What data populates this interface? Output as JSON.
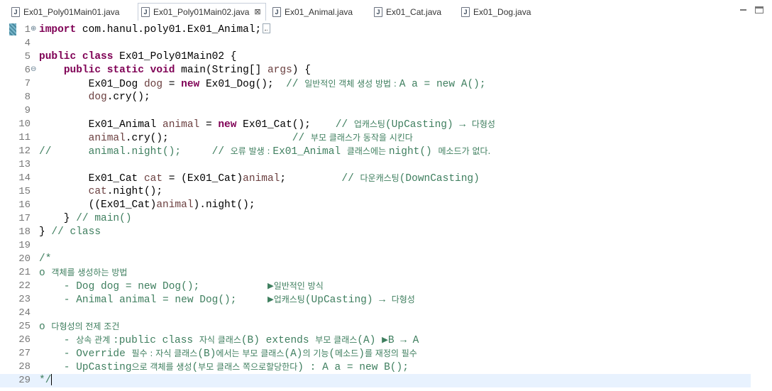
{
  "tabs": [
    {
      "label": "Ex01_Poly01Main01.java",
      "active": false
    },
    {
      "label": "Ex01_Poly01Main02.java",
      "active": true
    },
    {
      "label": "Ex01_Animal.java",
      "active": false
    },
    {
      "label": "Ex01_Cat.java",
      "active": false
    },
    {
      "label": "Ex01_Dog.java",
      "active": false
    }
  ],
  "icons": {
    "tab_file": "java-file-icon",
    "close": "close-icon",
    "minimize": "minimize-icon",
    "maximize": "maximize-icon"
  },
  "glyphs": {
    "file": "J",
    "close": "⊠"
  },
  "colors": {
    "keyword": "#7f0055",
    "comment": "#3f7f5f",
    "line_number": "#787878",
    "current_line": "#e8f2fe"
  },
  "editor": {
    "lines": [
      {
        "num": "1",
        "fold": "⊕",
        "segments": [
          [
            "kw",
            "import"
          ],
          [
            "t",
            " com.hanul.poly01.Ex01_Animal;"
          ]
        ],
        "collapsed": true
      },
      {
        "num": "4",
        "segments": []
      },
      {
        "num": "5",
        "segments": [
          [
            "kw",
            "public class"
          ],
          [
            "t",
            " Ex01_Poly01Main02 {"
          ]
        ]
      },
      {
        "num": "6",
        "fold": "⊖",
        "segments": [
          [
            "t",
            "    "
          ],
          [
            "kw",
            "public static void"
          ],
          [
            "t",
            " main(String[] "
          ],
          [
            "var",
            "args"
          ],
          [
            "t",
            ") {"
          ]
        ]
      },
      {
        "num": "7",
        "segments": [
          [
            "t",
            "        Ex01_Dog "
          ],
          [
            "var",
            "dog"
          ],
          [
            "t",
            " = "
          ],
          [
            "kw",
            "new"
          ],
          [
            "t",
            " Ex01_Dog();  "
          ],
          [
            "cm",
            "// "
          ],
          [
            "cmk",
            "일반적인 객체 생성 방법 : "
          ],
          [
            "cm",
            "A a = new A();"
          ]
        ]
      },
      {
        "num": "8",
        "segments": [
          [
            "t",
            "        "
          ],
          [
            "var",
            "dog"
          ],
          [
            "t",
            ".cry();"
          ]
        ]
      },
      {
        "num": "9",
        "segments": []
      },
      {
        "num": "10",
        "segments": [
          [
            "t",
            "        Ex01_Animal "
          ],
          [
            "var",
            "animal"
          ],
          [
            "t",
            " = "
          ],
          [
            "kw",
            "new"
          ],
          [
            "t",
            " Ex01_Cat();    "
          ],
          [
            "cm",
            "// "
          ],
          [
            "cmk",
            "업캐스팅"
          ],
          [
            "cm",
            "(UpCasting) → "
          ],
          [
            "cmk",
            "다형성"
          ]
        ]
      },
      {
        "num": "11",
        "segments": [
          [
            "t",
            "        "
          ],
          [
            "var",
            "animal"
          ],
          [
            "t",
            ".cry();                    "
          ],
          [
            "cm",
            "// "
          ],
          [
            "cmk",
            "부모 클래스가 동작을 시킨다"
          ]
        ]
      },
      {
        "num": "12",
        "segments": [
          [
            "cm",
            "//      animal.night();     // "
          ],
          [
            "cmk",
            "오류 발생 : "
          ],
          [
            "cm",
            "Ex01_Animal "
          ],
          [
            "cmk",
            "클래스에는 "
          ],
          [
            "cm",
            "night() "
          ],
          [
            "cmk",
            "메소드가 없다."
          ]
        ]
      },
      {
        "num": "13",
        "segments": []
      },
      {
        "num": "14",
        "segments": [
          [
            "t",
            "        Ex01_Cat "
          ],
          [
            "var",
            "cat"
          ],
          [
            "t",
            " = (Ex01_Cat)"
          ],
          [
            "var",
            "animal"
          ],
          [
            "t",
            ";         "
          ],
          [
            "cm",
            "// "
          ],
          [
            "cmk",
            "다운캐스팅"
          ],
          [
            "cm",
            "(DownCasting)"
          ]
        ]
      },
      {
        "num": "15",
        "segments": [
          [
            "t",
            "        "
          ],
          [
            "var",
            "cat"
          ],
          [
            "t",
            ".night();"
          ]
        ]
      },
      {
        "num": "16",
        "segments": [
          [
            "t",
            "        ((Ex01_Cat)"
          ],
          [
            "var",
            "animal"
          ],
          [
            "t",
            ").night();"
          ]
        ]
      },
      {
        "num": "17",
        "segments": [
          [
            "t",
            "    } "
          ],
          [
            "cm",
            "// main()"
          ]
        ]
      },
      {
        "num": "18",
        "segments": [
          [
            "t",
            "} "
          ],
          [
            "cm",
            "// class"
          ]
        ]
      },
      {
        "num": "19",
        "segments": []
      },
      {
        "num": "20",
        "segments": [
          [
            "cm",
            "/*"
          ]
        ]
      },
      {
        "num": "21",
        "segments": [
          [
            "cm",
            "o "
          ],
          [
            "cmk",
            "객체를 생성하는 방법"
          ]
        ]
      },
      {
        "num": "22",
        "segments": [
          [
            "cm",
            "    - Dog dog = new Dog();           ▶"
          ],
          [
            "cmk",
            "일반적인 방식"
          ]
        ]
      },
      {
        "num": "23",
        "segments": [
          [
            "cm",
            "    - Animal animal = new Dog();     ▶"
          ],
          [
            "cmk",
            "업캐스팅"
          ],
          [
            "cm",
            "(UpCasting) → "
          ],
          [
            "cmk",
            "다형성"
          ]
        ]
      },
      {
        "num": "24",
        "segments": []
      },
      {
        "num": "25",
        "segments": [
          [
            "cm",
            "o "
          ],
          [
            "cmk",
            "다형성의 전제 조건"
          ]
        ]
      },
      {
        "num": "26",
        "segments": [
          [
            "cm",
            "    - "
          ],
          [
            "cmk",
            "상속 관계 "
          ],
          [
            "cm",
            ":public class "
          ],
          [
            "cmk",
            "자식 클래스"
          ],
          [
            "cm",
            "(B) extends "
          ],
          [
            "cmk",
            "부모 클래스"
          ],
          [
            "cm",
            "(A) ▶B → A"
          ]
        ]
      },
      {
        "num": "27",
        "segments": [
          [
            "cm",
            "    - Override "
          ],
          [
            "cmk",
            "필수 : 자식 클래스"
          ],
          [
            "cm",
            "(B)"
          ],
          [
            "cmk",
            "에서는 부모 클래스"
          ],
          [
            "cm",
            "(A)"
          ],
          [
            "cmk",
            "의 기능"
          ],
          [
            "cm",
            "("
          ],
          [
            "cmk",
            "메소드"
          ],
          [
            "cm",
            ")"
          ],
          [
            "cmk",
            "를 재정의 필수"
          ]
        ]
      },
      {
        "num": "28",
        "segments": [
          [
            "cm",
            "    - UpCasting"
          ],
          [
            "cmk",
            "으로 객체를 생성"
          ],
          [
            "cm",
            "("
          ],
          [
            "cmk",
            "부모 클래스 쪽으로할당한다"
          ],
          [
            "cm",
            ") : A a = new B();"
          ]
        ]
      },
      {
        "num": "29",
        "segments": [
          [
            "cm",
            "*/"
          ]
        ],
        "current": true,
        "caret": true
      }
    ]
  }
}
